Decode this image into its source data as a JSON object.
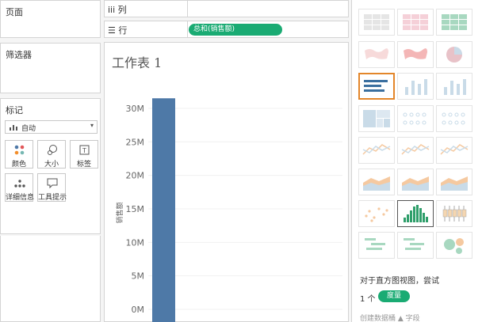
{
  "left": {
    "pages_title": "页面",
    "filters_title": "筛选器",
    "marks_title": "标记",
    "mark_type": "自动",
    "mark_buttons": [
      "颜色",
      "大小",
      "标签",
      "详细信息",
      "工具提示"
    ]
  },
  "shelves": {
    "columns_label": "iii 列",
    "rows_label": "☰ 行",
    "rows_pill": "总和(销售额)"
  },
  "sheet": {
    "title": "工作表 1"
  },
  "chart_data": {
    "type": "bar",
    "categories": [
      ""
    ],
    "values": [
      31.5
    ],
    "ylabel": "销售额",
    "yticks": [
      "0M",
      "5M",
      "10M",
      "15M",
      "20M",
      "25M",
      "30M"
    ],
    "ylim": [
      0,
      32
    ],
    "bar_color": "#4e79a7"
  },
  "showme": {
    "hint_line1": "对于直方图视图，尝试",
    "hint_count": "1 个",
    "hint_pill": "度量",
    "hint_line3": "创建数据桶 ▲ 字段"
  },
  "colors": {
    "accent_green": "#1aab73",
    "selected_orange": "#e3862a",
    "bar_blue": "#4e79a7"
  }
}
